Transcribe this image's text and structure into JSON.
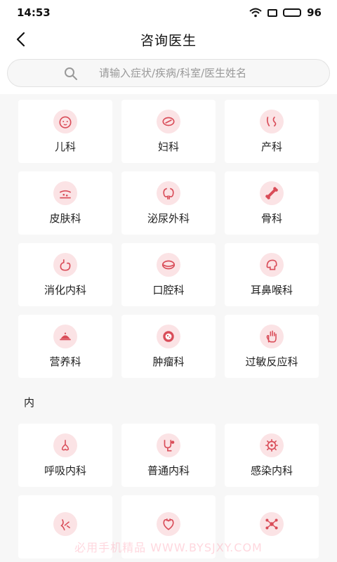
{
  "status": {
    "time": "14:53",
    "battery": "96"
  },
  "header": {
    "title": "咨询医生"
  },
  "search": {
    "placeholder": "请输入症状/疾病/科室/医生姓名"
  },
  "departments": [
    {
      "label": "儿科",
      "icon": "baby-face-icon"
    },
    {
      "label": "妇科",
      "icon": "female-icon"
    },
    {
      "label": "产科",
      "icon": "pregnancy-icon"
    },
    {
      "label": "皮肤科",
      "icon": "skin-icon"
    },
    {
      "label": "泌尿外科",
      "icon": "kidney-icon"
    },
    {
      "label": "骨科",
      "icon": "bone-icon"
    },
    {
      "label": "消化内科",
      "icon": "stomach-icon"
    },
    {
      "label": "口腔科",
      "icon": "mouth-icon"
    },
    {
      "label": "耳鼻喉科",
      "icon": "head-icon"
    },
    {
      "label": "营养科",
      "icon": "dish-icon"
    },
    {
      "label": "肿瘤科",
      "icon": "tumor-icon"
    },
    {
      "label": "过敏反应科",
      "icon": "hand-icon"
    }
  ],
  "section": {
    "title": "内"
  },
  "internal": [
    {
      "label": "呼吸内科",
      "icon": "nose-icon"
    },
    {
      "label": "普通内科",
      "icon": "stethoscope-icon"
    },
    {
      "label": "感染内科",
      "icon": "virus-icon"
    },
    {
      "label": "",
      "icon": "nerve-icon"
    },
    {
      "label": "",
      "icon": "heart-icon"
    },
    {
      "label": "",
      "icon": "molecule-icon"
    }
  ],
  "watermark": "必用手机精品 WWW.BYSJXY.COM",
  "colors": {
    "accent": "#e8505b",
    "icon_bg": "#fbe3e5",
    "page_bg": "#f7f7f7"
  }
}
